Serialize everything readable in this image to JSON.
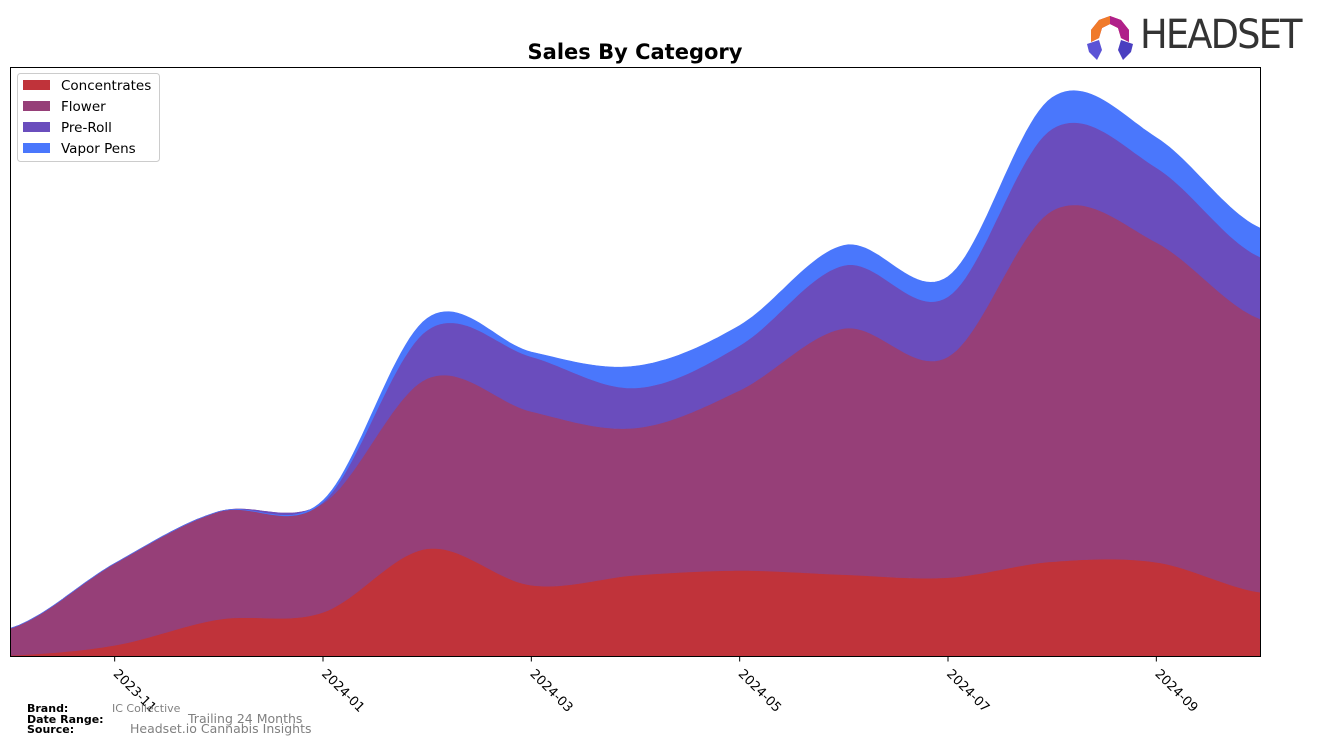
{
  "header": {
    "logo_text": "HEADSET"
  },
  "footer": {
    "brand_label": "Brand:",
    "brand_value": "IC Collective",
    "date_range_label": "Date Range:",
    "date_range_value": "Trailing 24 Months",
    "source_label": "Source:",
    "source_value": "Headset.io Cannabis Insights"
  },
  "chart_data": {
    "type": "area",
    "stacked": true,
    "smooth": true,
    "title": "Sales By Category",
    "xlabel": "",
    "ylabel": "",
    "x": [
      "2023-10",
      "2023-11",
      "2023-12",
      "2024-01",
      "2024-02",
      "2024-03",
      "2024-04",
      "2024-05",
      "2024-06",
      "2024-07",
      "2024-08",
      "2024-09",
      "2024-10"
    ],
    "x_tick_labels": [
      "2023-11",
      "2024-01",
      "2024-03",
      "2024-05",
      "2024-07",
      "2024-09"
    ],
    "ylim": [
      0,
      100
    ],
    "y_ticks_visible": false,
    "grid": false,
    "legend_position": "top-left",
    "series": [
      {
        "name": "Concentrates",
        "color": "#c0333a",
        "values": [
          0.2,
          1.9,
          6.3,
          7.5,
          18.3,
          12.1,
          13.8,
          14.6,
          13.9,
          13.4,
          16.1,
          16.0,
          10.9
        ]
      },
      {
        "name": "Flower",
        "color": "#963f78",
        "values": [
          4.6,
          13.9,
          18.3,
          18.5,
          28.9,
          29.5,
          25.0,
          30.6,
          41.8,
          37.5,
          59.6,
          54.3,
          46.4
        ]
      },
      {
        "name": "Pre-Roll",
        "color": "#6a4dbd",
        "values": [
          0.0,
          0.0,
          0.0,
          0.2,
          8.2,
          9.3,
          6.8,
          7.6,
          10.7,
          10.2,
          13.9,
          12.7,
          10.5
        ]
      },
      {
        "name": "Vapor Pens",
        "color": "#4a77fc",
        "values": [
          0.0,
          0.0,
          0.0,
          0.3,
          2.0,
          0.8,
          3.7,
          3.4,
          3.4,
          3.4,
          5.3,
          5.1,
          4.9
        ]
      }
    ]
  }
}
